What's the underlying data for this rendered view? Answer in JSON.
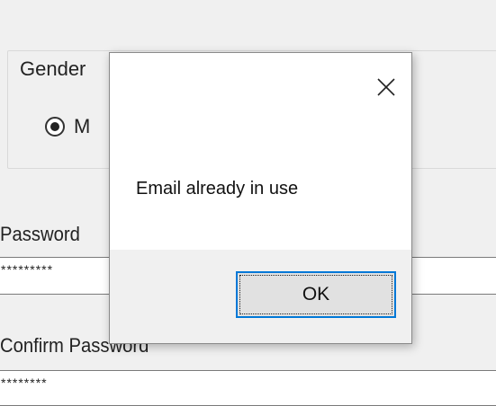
{
  "form": {
    "gender_label": "Gender",
    "gender_option_visible": "M",
    "password_label": "Password",
    "password_value": "*********",
    "confirm_password_label": "Confirm Password",
    "confirm_password_value": "********"
  },
  "dialog": {
    "message": "Email already in use",
    "ok_label": "OK",
    "close_icon": "close-icon",
    "accent_color": "#0078d7"
  }
}
